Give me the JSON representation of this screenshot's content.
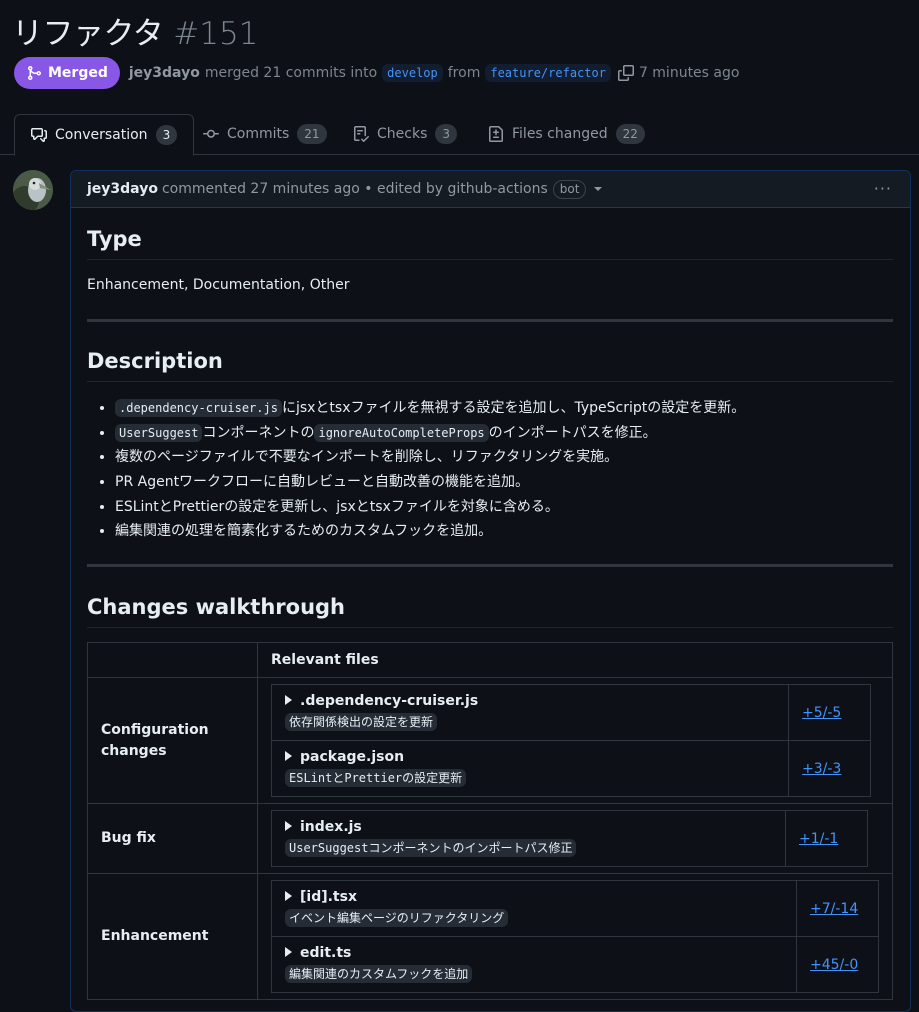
{
  "pr": {
    "title": "リファクタ",
    "number": "#151",
    "state_label": "Merged",
    "author": "jey3dayo",
    "merge_text": "merged 21 commits into",
    "base_branch": "develop",
    "from_text": "from",
    "head_branch": "feature/refactor",
    "time_ago": "7 minutes ago"
  },
  "tabs": [
    {
      "label": "Conversation",
      "count": "3",
      "icon": "comment-discussion-icon"
    },
    {
      "label": "Commits",
      "count": "21",
      "icon": "commit-icon"
    },
    {
      "label": "Checks",
      "count": "3",
      "icon": "checklist-icon"
    },
    {
      "label": "Files changed",
      "count": "22",
      "icon": "file-diff-icon"
    }
  ],
  "comment": {
    "author": "jey3dayo",
    "action_text": "commented 27 minutes ago • edited by github-actions",
    "bot_label": "bot",
    "menu_label": "···"
  },
  "content": {
    "type_heading": "Type",
    "type_text": "Enhancement, Documentation, Other",
    "desc_heading": "Description",
    "desc_items": [
      {
        "code1": ".dependency-cruiser.js",
        "text1": "にjsxとtsxファイルを無視する設定を追加し、TypeScriptの設定を更新。"
      },
      {
        "code1": "UserSuggest",
        "text1": "コンポーネントの",
        "code2": "ignoreAutoCompleteProps",
        "text2": "のインポートパスを修正。"
      },
      {
        "text1": "複数のページファイルで不要なインポートを削除し、リファクタリングを実施。"
      },
      {
        "text1": "PR Agentワークフローに自動レビューと自動改善の機能を追加。"
      },
      {
        "text1": "ESLintとPrettierの設定を更新し、jsxとtsxファイルを対象に含める。"
      },
      {
        "text1": "編集関連の処理を簡素化するためのカスタムフックを追加。"
      }
    ],
    "changes_heading": "Changes walkthrough",
    "files_header": "Relevant files",
    "categories": [
      {
        "name": "Configuration changes",
        "files": [
          {
            "name": ".dependency-cruiser.js",
            "desc": "依存関係検出の設定を更新",
            "diff": "+5/-5"
          },
          {
            "name": "package.json",
            "desc": "ESLintとPrettierの設定更新",
            "diff": "+3/-3"
          }
        ]
      },
      {
        "name": "Bug fix",
        "files": [
          {
            "name": "index.js",
            "desc": "UserSuggestコンポーネントのインポートパス修正",
            "diff": "+1/-1"
          }
        ]
      },
      {
        "name": "Enhancement",
        "files": [
          {
            "name": "[id].tsx",
            "desc": "イベント編集ページのリファクタリング",
            "diff": "+7/-14"
          },
          {
            "name": "edit.ts",
            "desc": "編集関連のカスタムフックを追加",
            "diff": "+45/-0"
          }
        ]
      }
    ]
  }
}
